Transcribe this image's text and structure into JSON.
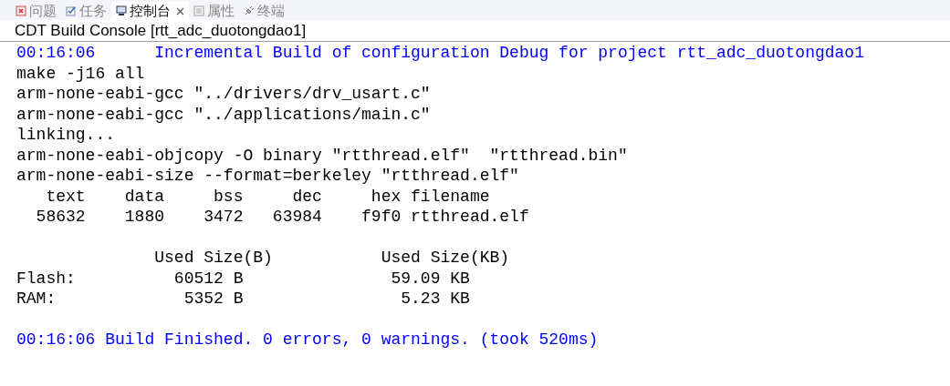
{
  "tabs": [
    {
      "label": "问题",
      "selected": false
    },
    {
      "label": "任务",
      "selected": false
    },
    {
      "label": "控制台",
      "selected": true,
      "closable": true
    },
    {
      "label": "属性",
      "selected": false
    },
    {
      "label": "终端",
      "selected": false
    }
  ],
  "console": {
    "title": "CDT Build Console [rtt_adc_duotongdao1]",
    "lines": [
      {
        "kind": "info",
        "text": "00:16:06      Incremental Build of configuration Debug for project rtt_adc_duotongdao1"
      },
      {
        "kind": "output",
        "text": "make -j16 all"
      },
      {
        "kind": "output",
        "text": "arm-none-eabi-gcc \"../drivers/drv_usart.c\""
      },
      {
        "kind": "output",
        "text": "arm-none-eabi-gcc \"../applications/main.c\""
      },
      {
        "kind": "output",
        "text": "linking..."
      },
      {
        "kind": "output",
        "text": "arm-none-eabi-objcopy -O binary \"rtthread.elf\"  \"rtthread.bin\""
      },
      {
        "kind": "output",
        "text": "arm-none-eabi-size --format=berkeley \"rtthread.elf\""
      },
      {
        "kind": "output",
        "text": "   text    data     bss     dec     hex filename"
      },
      {
        "kind": "output",
        "text": "  58632    1880    3472   63984    f9f0 rtthread.elf"
      },
      {
        "kind": "blank"
      },
      {
        "kind": "output",
        "text": "              Used Size(B)           Used Size(KB)"
      },
      {
        "kind": "output",
        "text": "Flash:          60512 B               59.09 KB"
      },
      {
        "kind": "output",
        "text": "RAM:             5352 B                5.23 KB"
      },
      {
        "kind": "blank"
      },
      {
        "kind": "info",
        "text": "00:16:06 Build Finished. 0 errors, 0 warnings. (took 520ms)"
      }
    ]
  }
}
